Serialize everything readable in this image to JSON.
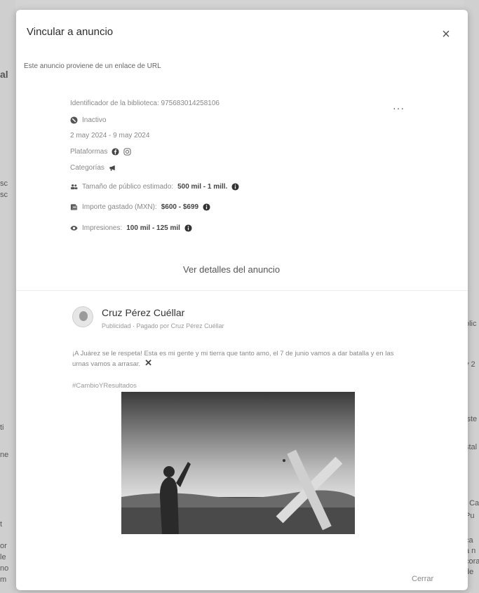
{
  "background": {
    "left_fragments": [
      "al",
      "sc",
      "sc",
      "ti",
      "ne",
      "t",
      "or",
      "le",
      "no",
      "m"
    ],
    "right_fragments": [
      "olic",
      "y 2",
      "iste",
      "stal",
      ": Ca",
      "Pu",
      "ca",
      "a n",
      "cora",
      "de"
    ]
  },
  "modal": {
    "title": "Vincular a anuncio",
    "subtitle": "Este anuncio proviene de un enlace de URL",
    "close_icon": "close-icon"
  },
  "ad_info": {
    "library_id": "Identificador de la biblioteca: 975683014258106",
    "status": "Inactivo",
    "dates": "2 may 2024 - 9 may 2024",
    "platforms_label": "Plataformas",
    "categories_label": "Categorías",
    "audience_label": "Tamaño de público estimado:",
    "audience_value": "500 mil - 1 mill.",
    "spend_label": "Importe gastado (MXN):",
    "spend_value": "$600 - $699",
    "impressions_label": "Impresiones:",
    "impressions_value": "100 mil - 125 mil",
    "menu": "···"
  },
  "details_link": "Ver detalles del anuncio",
  "advertiser": {
    "name": "Cruz Pérez Cuéllar",
    "subtitle": "Publicidad · Pagado por Cruz Pérez Cuéllar"
  },
  "ad_copy": "¡A Juárez se le respeta! Esta es mi gente y mi tierra que tanto amo, el 7 de junio vamos a dar batalla y en las urnas vamos a arrasar.",
  "ad_copy_mark": "✕",
  "hashtag": "#CambioYResultados",
  "footer": {
    "close_label": "Cerrar"
  }
}
